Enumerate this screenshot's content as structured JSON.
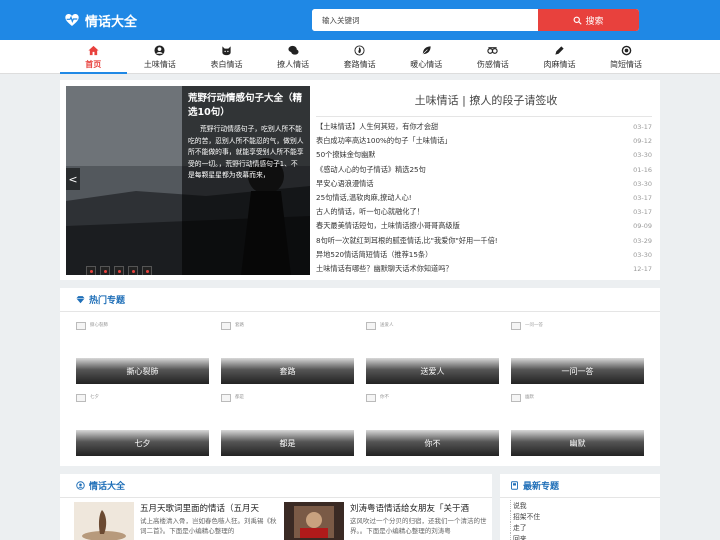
{
  "header": {
    "site_name": "情话大全",
    "search_placeholder": "输入关键词",
    "search_button": "搜索"
  },
  "nav": [
    {
      "label": "首页",
      "icon": "home-icon",
      "active": true
    },
    {
      "label": "土味情话",
      "icon": "user-icon"
    },
    {
      "label": "表白情话",
      "icon": "cat-icon"
    },
    {
      "label": "撩人情话",
      "icon": "chat-icon"
    },
    {
      "label": "套路情话",
      "icon": "flame-icon"
    },
    {
      "label": "暖心情话",
      "icon": "leaf-icon"
    },
    {
      "label": "伤感情话",
      "icon": "glasses-icon"
    },
    {
      "label": "肉麻情话",
      "icon": "pen-icon"
    },
    {
      "label": "简短情话",
      "icon": "ring-icon"
    }
  ],
  "slider": {
    "title": "荒野行动情感句子大全（精选10句）",
    "text": "荒野行动情感句子，吃别人所不能吃的苦，忍别人所不能忍的气，做别人所不能做的事，就能享受别人所不能享受的一切。，荒野行动情感句子1、不是每颗星星都为夜幕而来，",
    "prev": "<"
  },
  "feature": {
    "title": "土味情话 | 撩人的段子请签收",
    "items": [
      {
        "text": "【土味情话】人生何其短，有你才会甜",
        "date": "03-17"
      },
      {
        "text": "表白成功率高达100%的句子「土味情话」",
        "date": "09-12"
      },
      {
        "text": "50个撩妹金句幽默",
        "date": "03-30"
      },
      {
        "text": "《感动人心的句子情话》精选25句",
        "date": "01-16"
      },
      {
        "text": "早安心语浪漫情话",
        "date": "03-30"
      },
      {
        "text": "25句情话,温软肉麻,撩动人心!",
        "date": "03-17"
      },
      {
        "text": "古人的情话，听一句心就融化了！",
        "date": "03-17"
      },
      {
        "text": "春天最美情话短句，土味情话撩小哥哥高级版",
        "date": "09-09"
      },
      {
        "text": "8句听一次就红到耳根的腻歪情话,比\"我爱你\"好用一千倍!",
        "date": "03-29"
      },
      {
        "text": "异地520情话简短情话（推荐15条）",
        "date": "03-30"
      },
      {
        "text": "土味情话有哪些？幽默聊天话术你知道吗？",
        "date": "12-17"
      }
    ]
  },
  "topics": {
    "title": "热门专题",
    "items": [
      {
        "label": "撕心裂肺",
        "alt": "撕心裂肺"
      },
      {
        "label": "套路",
        "alt": "套路"
      },
      {
        "label": "送爱人",
        "alt": "送爱人"
      },
      {
        "label": "一问一答",
        "alt": "一问一答"
      },
      {
        "label": "七夕",
        "alt": "七夕"
      },
      {
        "label": "都是",
        "alt": "都是"
      },
      {
        "label": "你不",
        "alt": "你不"
      },
      {
        "label": "幽默",
        "alt": "幽默"
      }
    ]
  },
  "articles": {
    "title": "情话大全",
    "items": [
      {
        "title": "五月天歌词里面的情话（五月天",
        "text": "试上高楼清入骨，岂如春色嗾人狂。刘禹锡《秋词二首》。下面是小编精心整理的"
      },
      {
        "title": "刘涛粤语情话给女朋友「关于酒",
        "text": "这风吹过一个分贝的归宿，还我们一个清洁的世界。。下面是小编精心整理的刘涛粤"
      }
    ]
  },
  "latest": {
    "title": "最新专题",
    "items": [
      "说我",
      "招架不住",
      "走了",
      "回来"
    ]
  },
  "colors": {
    "brand": "#1f88e5",
    "accent": "#e8413d"
  }
}
